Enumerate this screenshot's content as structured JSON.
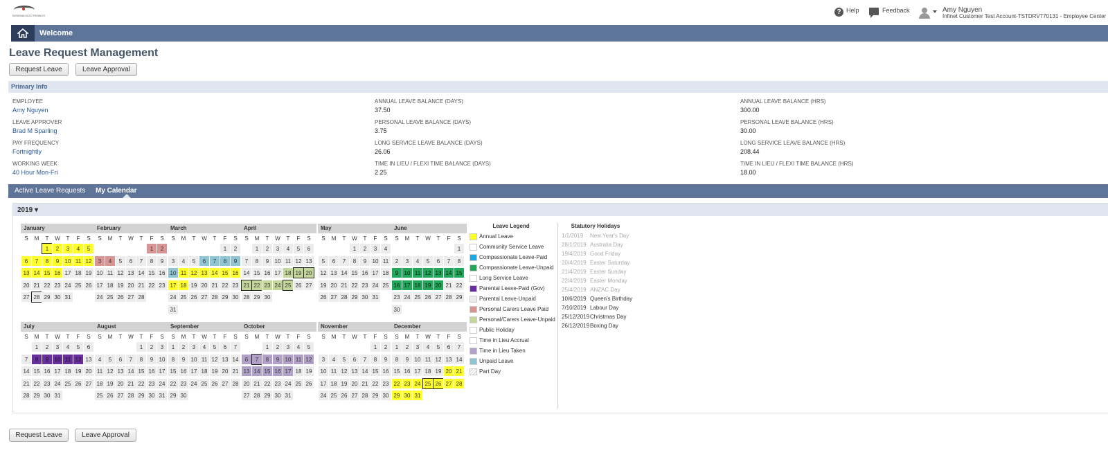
{
  "header": {
    "logo_text": "INSIGNIA ELECTRONICS",
    "help": "Help",
    "feedback": "Feedback",
    "user_name": "Amy Nguyen",
    "user_account": "Infinet Customer Test Account-TSTDRV770131 - Employee Center"
  },
  "nav": {
    "welcome": "Welcome"
  },
  "page": {
    "title": "Leave Request Management",
    "request_button": "Request Leave",
    "approval_button": "Leave Approval"
  },
  "primary_info": {
    "title": "Primary Info",
    "fields": [
      {
        "label": "EMPLOYEE",
        "value": "Amy Nguyen",
        "link": true
      },
      {
        "label": "LEAVE APPROVER",
        "value": "Brad M Sparling",
        "link": true
      },
      {
        "label": "PAY FREQUENCY",
        "value": "Fortnightly",
        "link": true
      },
      {
        "label": "WORKING WEEK",
        "value": "40 Hour Mon-Fri",
        "link": true
      },
      {
        "label": "ANNUAL LEAVE BALANCE (DAYS)",
        "value": "37.50",
        "link": false
      },
      {
        "label": "PERSONAL LEAVE BALANCE (DAYS)",
        "value": "3.75",
        "link": false
      },
      {
        "label": "LONG SERVICE LEAVE BALANCE (DAYS)",
        "value": "26.06",
        "link": false
      },
      {
        "label": "TIME IN LIEU / FLEXI TIME BALANCE (DAYS)",
        "value": "2.25",
        "link": false
      },
      {
        "label": "ANNUAL LEAVE BALANCE (HRS)",
        "value": "300.00",
        "link": false
      },
      {
        "label": "PERSONAL LEAVE BALANCE (HRS)",
        "value": "30.00",
        "link": false
      },
      {
        "label": "LONG SERVICE LEAVE BALANCE (HRS)",
        "value": "208.44",
        "link": false
      },
      {
        "label": "TIME IN LIEU / FLEXI TIME BALANCE (HRS)",
        "value": "18.00",
        "link": false
      }
    ]
  },
  "tabs": {
    "active_requests": "Active Leave Requests",
    "my_calendar": "My Calendar"
  },
  "calendar": {
    "year_label": "2019 ▾",
    "weekday_labels": [
      "S",
      "M",
      "T",
      "W",
      "T",
      "F",
      "S"
    ],
    "months": [
      {
        "name": "January",
        "start": 2,
        "days": 31,
        "marks": {
          "1": "yellow",
          "2": "yellow",
          "3": "yellow",
          "4": "yellow",
          "5": "yellow",
          "6": "yellow",
          "7": "yellow",
          "8": "yellow",
          "9": "yellow",
          "10": "yellow",
          "11": "yellow",
          "12": "yellow",
          "13": "yellow",
          "14": "yellow",
          "15": "yellow",
          "16": "yellow"
        },
        "selected": [
          1,
          28
        ]
      },
      {
        "name": "February",
        "start": 5,
        "days": 28,
        "marks": {
          "1": "pink",
          "2": "pink",
          "3": "pink",
          "4": "pink"
        },
        "selected": []
      },
      {
        "name": "March",
        "start": 5,
        "days": 31,
        "marks": {
          "6": "lightblue",
          "7": "lightblue",
          "8": "lightblue",
          "9": "lightblue",
          "10": "lightblue",
          "11": "yellow",
          "12": "yellow",
          "13": "yellow",
          "14": "yellow",
          "15": "yellow",
          "16": "yellow",
          "17": "yellow",
          "18": "yellow"
        },
        "selected": []
      },
      {
        "name": "April",
        "start": 1,
        "days": 30,
        "marks": {
          "18": "olive",
          "19": "olive",
          "20": "olive",
          "21": "olive",
          "22": "olive",
          "23": "olive",
          "24": "olive",
          "25": "olive"
        },
        "selected": [
          19,
          20,
          21,
          22,
          25
        ]
      },
      {
        "name": "May",
        "start": 3,
        "days": 31,
        "marks": {},
        "selected": []
      },
      {
        "name": "June",
        "start": 6,
        "days": 30,
        "marks": {
          "9": "green",
          "10": "green",
          "11": "green",
          "12": "green",
          "13": "green",
          "14": "green",
          "15": "green",
          "16": "green",
          "17": "green",
          "18": "green",
          "19": "green",
          "20": "green"
        },
        "selected": []
      },
      {
        "name": "July",
        "start": 1,
        "days": 31,
        "marks": {
          "8": "purple",
          "9": "purple",
          "10": "purple",
          "11": "purple",
          "12": "purple"
        },
        "selected": []
      },
      {
        "name": "August",
        "start": 4,
        "days": 31,
        "marks": {},
        "selected": []
      },
      {
        "name": "September",
        "start": 0,
        "days": 30,
        "marks": {},
        "selected": []
      },
      {
        "name": "October",
        "start": 2,
        "days": 31,
        "marks": {
          "6": "lavender",
          "7": "lavender",
          "8": "lavender",
          "9": "lavender",
          "10": "lavender",
          "11": "lavender",
          "12": "lavender",
          "13": "lavender",
          "14": "lavender",
          "15": "lavender",
          "16": "lavender",
          "17": "lavender"
        },
        "selected": [
          7
        ]
      },
      {
        "name": "November",
        "start": 5,
        "days": 30,
        "marks": {},
        "selected": []
      },
      {
        "name": "December",
        "start": 0,
        "days": 31,
        "marks": {
          "20": "yellow",
          "21": "yellow",
          "22": "yellow",
          "23": "yellow",
          "24": "yellow",
          "25": "yellow",
          "26": "yellow",
          "27": "yellow",
          "28": "yellow",
          "29": "yellow",
          "30": "yellow",
          "31": "yellow"
        },
        "selected": [
          25,
          26
        ]
      }
    ],
    "colors": {
      "yellow": "#ffff2a",
      "pink": "#d99494",
      "lightblue": "#8fc4d3",
      "olive": "#c4d79b",
      "green": "#21a85a",
      "purple": "#6a2f9e",
      "lavender": "#b1a0c7"
    }
  },
  "legend": {
    "title": "Leave Legend",
    "items": [
      {
        "label": "Annual Leave",
        "color": "#ffff2a"
      },
      {
        "label": "Community Service Leave",
        "color": "#ffffff"
      },
      {
        "label": "Compassionate Leave-Paid",
        "color": "#1ea7e1"
      },
      {
        "label": "Compassionate Leave-Unpaid",
        "color": "#21a85a"
      },
      {
        "label": "Long Service Leave",
        "color": "#ffffff"
      },
      {
        "label": "Parental Leave-Paid (Gov)",
        "color": "#6a2f9e"
      },
      {
        "label": "Parental Leave-Unpaid",
        "color": "#ececec"
      },
      {
        "label": "Personal Carers Leave Paid",
        "color": "#d99494"
      },
      {
        "label": "Personal/Carers Leave-Unpaid",
        "color": "#c4d79b"
      },
      {
        "label": "Public Holiday",
        "color": "#ffffff"
      },
      {
        "label": "Time in Lieu Accrual",
        "color": "#ffffff"
      },
      {
        "label": "Time in Lieu Taken",
        "color": "#b1a0c7"
      },
      {
        "label": "Unpaid Leave",
        "color": "#8fc4d3"
      },
      {
        "label": "Part Day",
        "color": "#ffffff"
      }
    ]
  },
  "holidays": {
    "title": "Statutory Holidays",
    "items": [
      {
        "date": "1/1/2019",
        "name": "New Year's Day",
        "past": true
      },
      {
        "date": "28/1/2019",
        "name": "Australia Day",
        "past": true
      },
      {
        "date": "19/4/2019",
        "name": "Good Friday",
        "past": true
      },
      {
        "date": "20/4/2019",
        "name": "Easter Saturday",
        "past": true
      },
      {
        "date": "21/4/2019",
        "name": "Easter Sunday",
        "past": true
      },
      {
        "date": "22/4/2019",
        "name": "Easter Monday",
        "past": true
      },
      {
        "date": "25/4/2019",
        "name": "ANZAC Day",
        "past": true
      },
      {
        "date": "10/6/2019",
        "name": "Queen's Birthday",
        "past": false
      },
      {
        "date": "7/10/2019",
        "name": "Labour Day",
        "past": false
      },
      {
        "date": "25/12/2019",
        "name": "Christmas Day",
        "past": false
      },
      {
        "date": "26/12/2019",
        "name": "Boxing Day",
        "past": false
      }
    ]
  }
}
